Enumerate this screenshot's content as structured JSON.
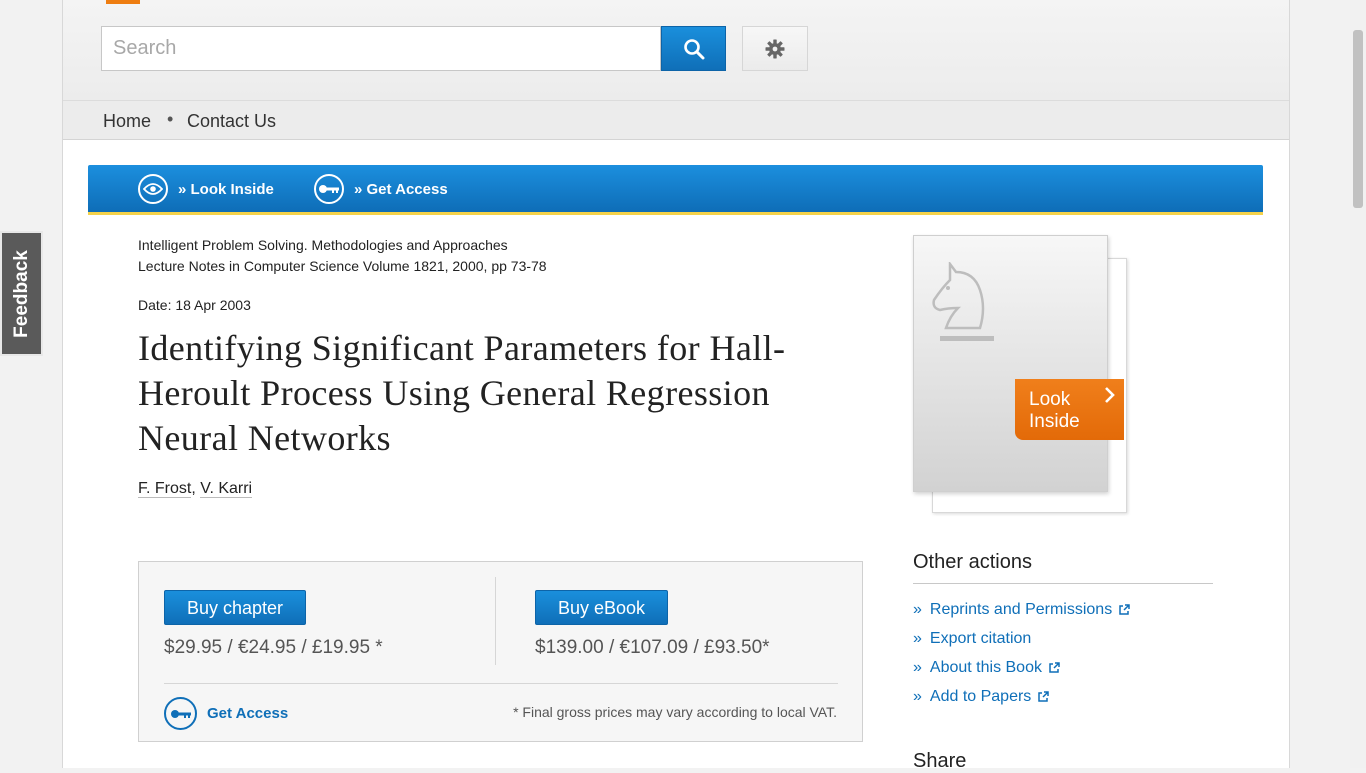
{
  "header": {
    "search_placeholder": "Search"
  },
  "nav": {
    "items": [
      "Home",
      "Contact Us"
    ],
    "separator": "•"
  },
  "bluebar": {
    "look_inside": "» Look Inside",
    "get_access": "» Get Access"
  },
  "article": {
    "book_title": "Intelligent Problem Solving. Methodologies and Approaches",
    "series": "Lecture Notes in Computer Science Volume 1821, 2000, pp 73-78",
    "date": "Date: 18 Apr 2003",
    "title": "Identifying Significant Parameters for Hall-Heroult Process Using General Regression Neural Networks",
    "authors": [
      "F. Frost",
      "V. Karri"
    ],
    "author_sep": ", "
  },
  "buybox": {
    "buy_chapter_label": "Buy chapter",
    "chapter_price": "$29.95 / €24.95 / £19.95 *",
    "buy_ebook_label": "Buy eBook",
    "ebook_price": "$139.00 / €107.09 / £93.50*",
    "get_access_label": "Get Access",
    "vat_note": "* Final gross prices may vary according to local VAT."
  },
  "cover": {
    "look_inside_line1": "Look",
    "look_inside_line2": "Inside"
  },
  "sidebar": {
    "heading": "Other actions",
    "items": [
      "Reprints and Permissions",
      "Export citation",
      "About this Book",
      "Add to Papers"
    ],
    "item_marker": "»",
    "share_heading": "Share"
  },
  "feedback": {
    "label": "Feedback"
  },
  "colors": {
    "accent_blue": "#0f6fb8",
    "orange": "#e36a08",
    "bar_underline": "#f5d24a"
  }
}
